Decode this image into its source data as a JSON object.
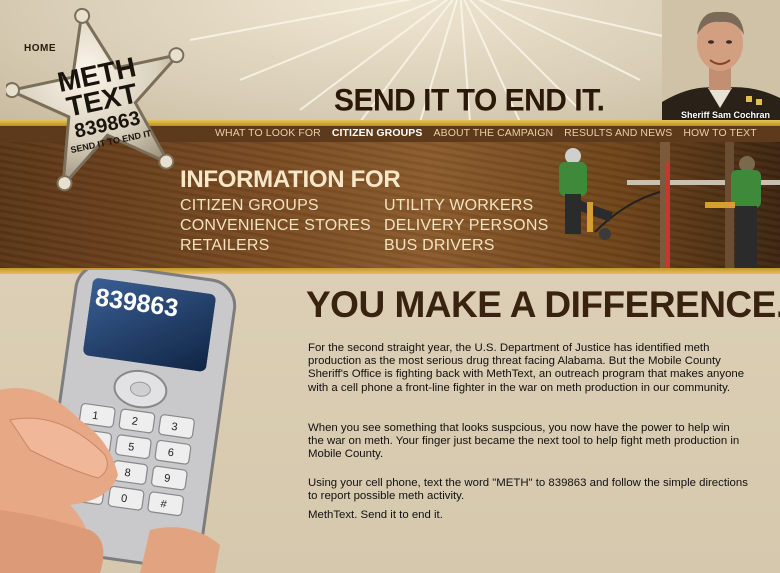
{
  "header": {
    "home_label": "HOME",
    "tagline": "SEND IT TO END IT.",
    "sheriff_caption": "Sheriff Sam Cochran"
  },
  "logo": {
    "line1": "METH",
    "line2": "TEXT",
    "number": "839863",
    "slogan": "SEND IT TO END IT"
  },
  "nav": {
    "items": [
      {
        "label": "WHAT TO LOOK FOR"
      },
      {
        "label": "CITIZEN GROUPS"
      },
      {
        "label": "ABOUT THE CAMPAIGN"
      },
      {
        "label": "RESULTS AND NEWS"
      },
      {
        "label": "HOW TO TEXT"
      }
    ],
    "active_index": 1
  },
  "info": {
    "title": "INFORMATION FOR",
    "links": [
      "CITIZEN GROUPS",
      "UTILITY WORKERS",
      "CONVENIENCE STORES",
      "DELIVERY PERSONS",
      "RETAILERS",
      "BUS DRIVERS"
    ]
  },
  "main": {
    "headline": "YOU MAKE A DIFFERENCE.",
    "paragraphs": [
      "For the second straight year, the U.S. Department of Justice has identified meth production as the most serious drug threat facing Alabama. But the Mobile County Sheriff's Office is fighting back with MethText, an outreach program that makes anyone with a cell phone a front-line fighter in the war on meth production in our community.",
      "When you see something that looks suspcious, you now have the power to help win the war on meth. Your finger just became the next tool to help fight meth production in Mobile County.",
      "Using your cell phone, text the word \"METH\" to 839863 and follow the simple directions to report possible meth activity.",
      "MethText. Send it to end it."
    ],
    "phone_screen": "839863"
  },
  "colors": {
    "accent_gold": "#d9b245",
    "brown_dark": "#3a2210",
    "nav_bg": "#5e3a1c"
  }
}
